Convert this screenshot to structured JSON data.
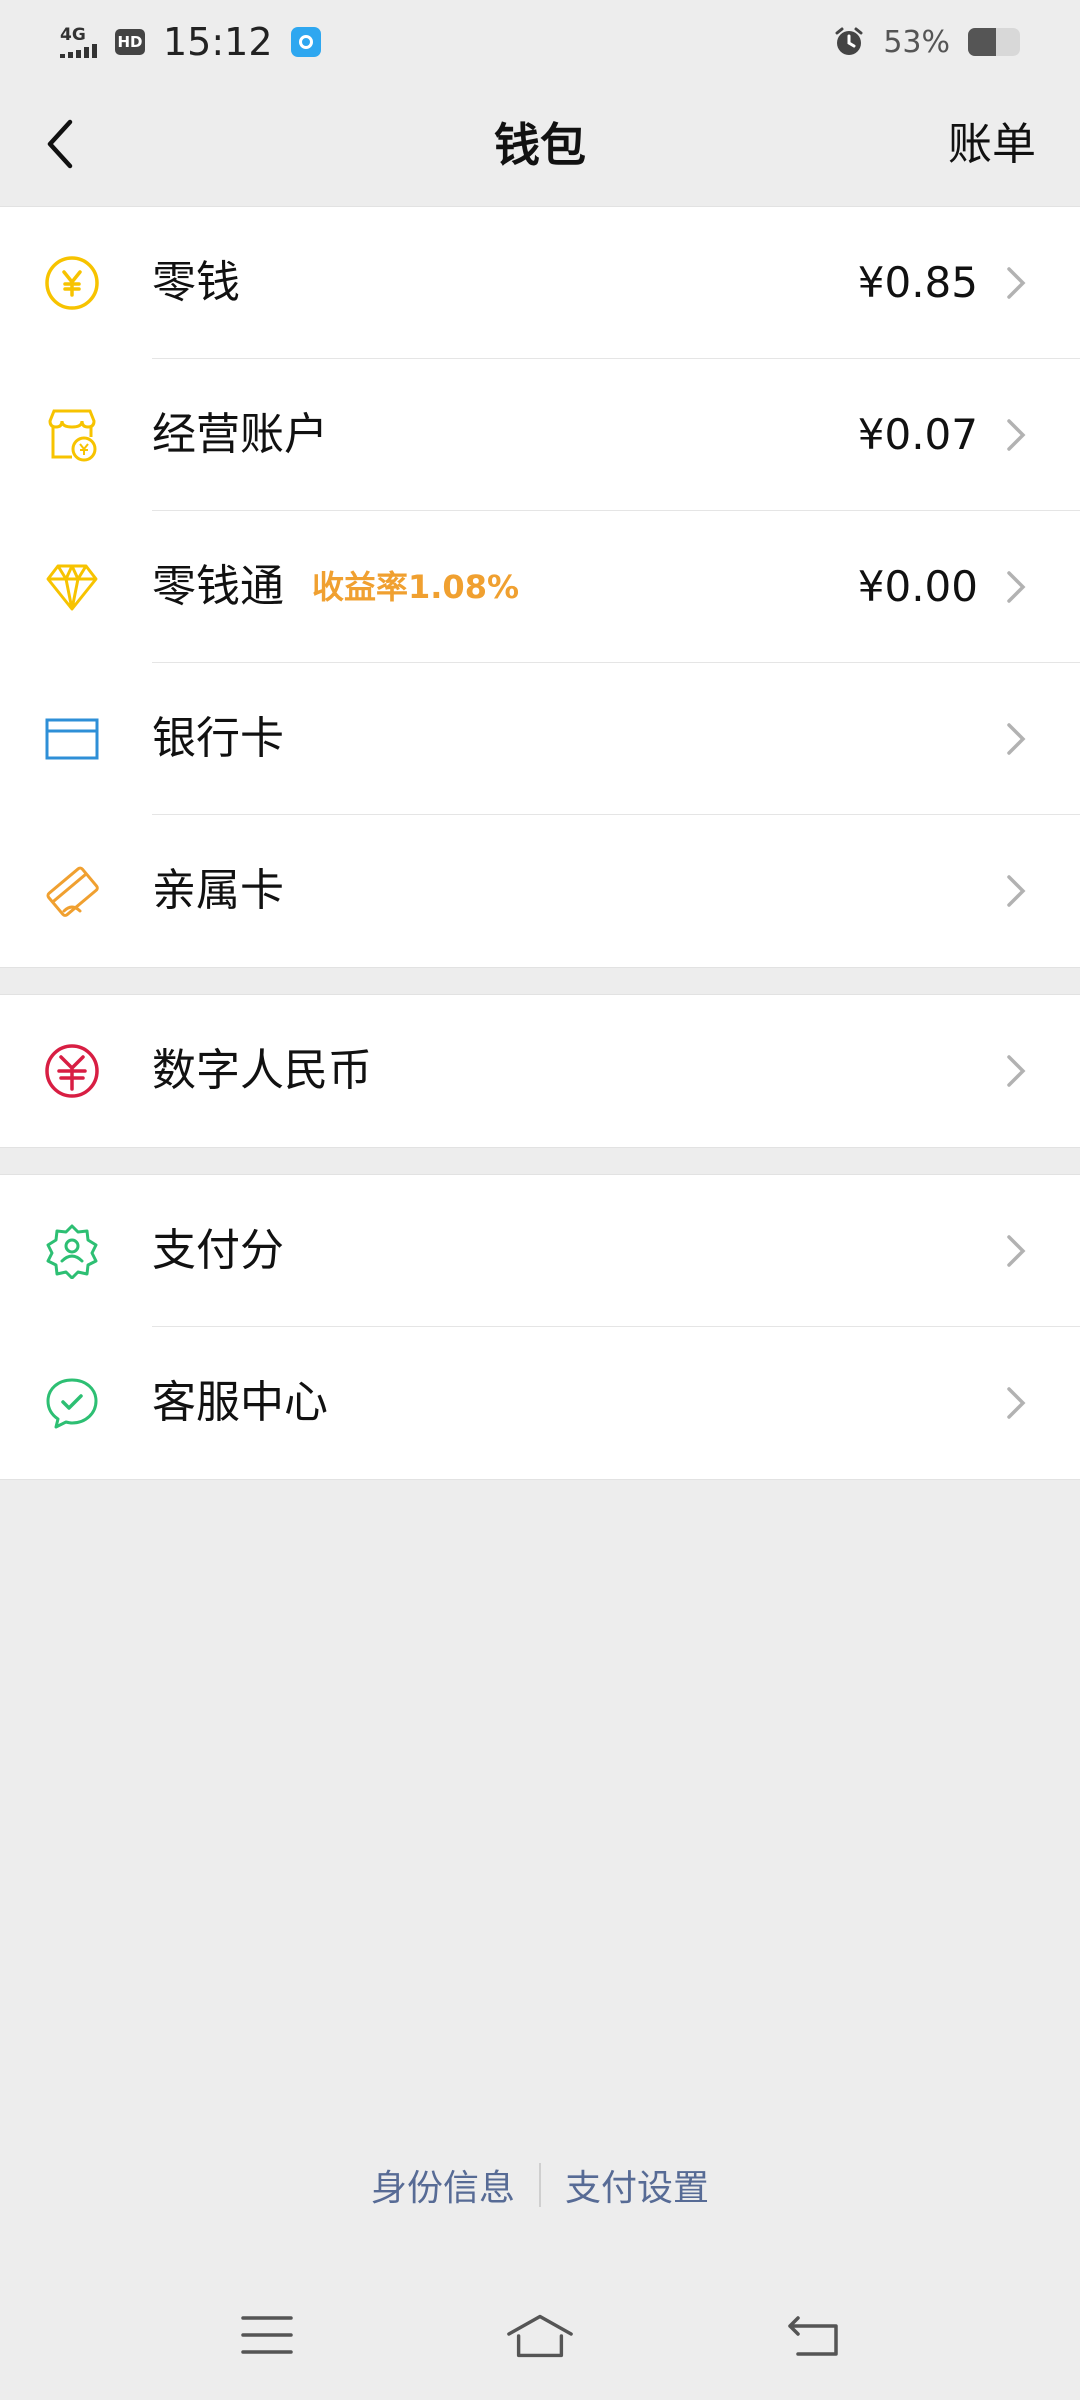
{
  "status_bar": {
    "network": "4G",
    "hd": "HD",
    "time": "15:12",
    "battery_percent": "53%",
    "battery_level": 0.53
  },
  "nav": {
    "title": "钱包",
    "action": "账单"
  },
  "group1": [
    {
      "label": "零钱",
      "amount": "¥0.85",
      "icon": "yuan-coin-icon",
      "color": "#f7c300"
    },
    {
      "label": "经营账户",
      "amount": "¥0.07",
      "icon": "store-account-icon",
      "color": "#f7c300"
    },
    {
      "label": "零钱通",
      "tag": "收益率1.08%",
      "amount": "¥0.00",
      "icon": "diamond-icon",
      "color": "#f7c300"
    },
    {
      "label": "银行卡",
      "icon": "bank-card-icon",
      "color": "#2e8fd7"
    },
    {
      "label": "亲属卡",
      "icon": "family-card-icon",
      "color": "#f0a030"
    }
  ],
  "group2": [
    {
      "label": "数字人民币",
      "icon": "digital-rmb-icon",
      "color": "#d81e43"
    }
  ],
  "group3": [
    {
      "label": "支付分",
      "icon": "pay-score-icon",
      "color": "#2dbf73"
    },
    {
      "label": "客服中心",
      "icon": "customer-service-icon",
      "color": "#2dbf73"
    }
  ],
  "footer": {
    "identity": "身份信息",
    "pay_settings": "支付设置"
  },
  "colors": {
    "accent_tag": "#f0a030",
    "link": "#576b95",
    "background": "#ededed"
  }
}
